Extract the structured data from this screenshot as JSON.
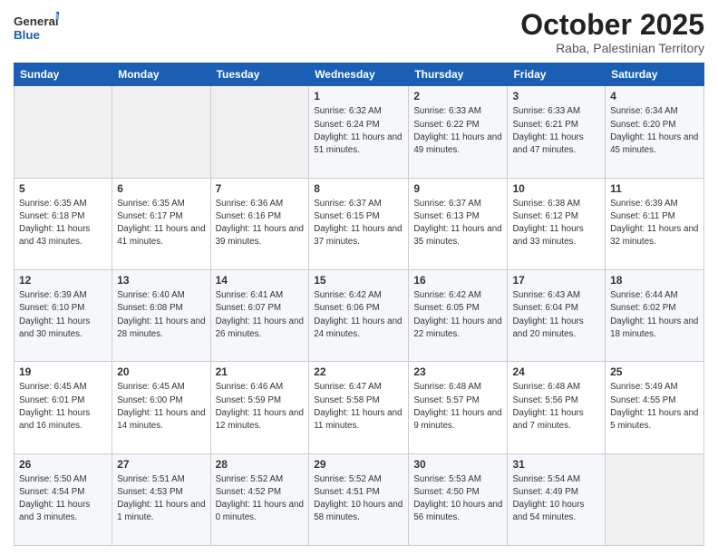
{
  "header": {
    "logo_general": "General",
    "logo_blue": "Blue",
    "main_title": "October 2025",
    "subtitle": "Raba, Palestinian Territory"
  },
  "days_of_week": [
    "Sunday",
    "Monday",
    "Tuesday",
    "Wednesday",
    "Thursday",
    "Friday",
    "Saturday"
  ],
  "weeks": [
    [
      {
        "day": "",
        "sunrise": "",
        "sunset": "",
        "daylight": "",
        "empty": true
      },
      {
        "day": "",
        "sunrise": "",
        "sunset": "",
        "daylight": "",
        "empty": true
      },
      {
        "day": "",
        "sunrise": "",
        "sunset": "",
        "daylight": "",
        "empty": true
      },
      {
        "day": "1",
        "sunrise": "Sunrise: 6:32 AM",
        "sunset": "Sunset: 6:24 PM",
        "daylight": "Daylight: 11 hours and 51 minutes."
      },
      {
        "day": "2",
        "sunrise": "Sunrise: 6:33 AM",
        "sunset": "Sunset: 6:22 PM",
        "daylight": "Daylight: 11 hours and 49 minutes."
      },
      {
        "day": "3",
        "sunrise": "Sunrise: 6:33 AM",
        "sunset": "Sunset: 6:21 PM",
        "daylight": "Daylight: 11 hours and 47 minutes."
      },
      {
        "day": "4",
        "sunrise": "Sunrise: 6:34 AM",
        "sunset": "Sunset: 6:20 PM",
        "daylight": "Daylight: 11 hours and 45 minutes."
      }
    ],
    [
      {
        "day": "5",
        "sunrise": "Sunrise: 6:35 AM",
        "sunset": "Sunset: 6:18 PM",
        "daylight": "Daylight: 11 hours and 43 minutes."
      },
      {
        "day": "6",
        "sunrise": "Sunrise: 6:35 AM",
        "sunset": "Sunset: 6:17 PM",
        "daylight": "Daylight: 11 hours and 41 minutes."
      },
      {
        "day": "7",
        "sunrise": "Sunrise: 6:36 AM",
        "sunset": "Sunset: 6:16 PM",
        "daylight": "Daylight: 11 hours and 39 minutes."
      },
      {
        "day": "8",
        "sunrise": "Sunrise: 6:37 AM",
        "sunset": "Sunset: 6:15 PM",
        "daylight": "Daylight: 11 hours and 37 minutes."
      },
      {
        "day": "9",
        "sunrise": "Sunrise: 6:37 AM",
        "sunset": "Sunset: 6:13 PM",
        "daylight": "Daylight: 11 hours and 35 minutes."
      },
      {
        "day": "10",
        "sunrise": "Sunrise: 6:38 AM",
        "sunset": "Sunset: 6:12 PM",
        "daylight": "Daylight: 11 hours and 33 minutes."
      },
      {
        "day": "11",
        "sunrise": "Sunrise: 6:39 AM",
        "sunset": "Sunset: 6:11 PM",
        "daylight": "Daylight: 11 hours and 32 minutes."
      }
    ],
    [
      {
        "day": "12",
        "sunrise": "Sunrise: 6:39 AM",
        "sunset": "Sunset: 6:10 PM",
        "daylight": "Daylight: 11 hours and 30 minutes."
      },
      {
        "day": "13",
        "sunrise": "Sunrise: 6:40 AM",
        "sunset": "Sunset: 6:08 PM",
        "daylight": "Daylight: 11 hours and 28 minutes."
      },
      {
        "day": "14",
        "sunrise": "Sunrise: 6:41 AM",
        "sunset": "Sunset: 6:07 PM",
        "daylight": "Daylight: 11 hours and 26 minutes."
      },
      {
        "day": "15",
        "sunrise": "Sunrise: 6:42 AM",
        "sunset": "Sunset: 6:06 PM",
        "daylight": "Daylight: 11 hours and 24 minutes."
      },
      {
        "day": "16",
        "sunrise": "Sunrise: 6:42 AM",
        "sunset": "Sunset: 6:05 PM",
        "daylight": "Daylight: 11 hours and 22 minutes."
      },
      {
        "day": "17",
        "sunrise": "Sunrise: 6:43 AM",
        "sunset": "Sunset: 6:04 PM",
        "daylight": "Daylight: 11 hours and 20 minutes."
      },
      {
        "day": "18",
        "sunrise": "Sunrise: 6:44 AM",
        "sunset": "Sunset: 6:02 PM",
        "daylight": "Daylight: 11 hours and 18 minutes."
      }
    ],
    [
      {
        "day": "19",
        "sunrise": "Sunrise: 6:45 AM",
        "sunset": "Sunset: 6:01 PM",
        "daylight": "Daylight: 11 hours and 16 minutes."
      },
      {
        "day": "20",
        "sunrise": "Sunrise: 6:45 AM",
        "sunset": "Sunset: 6:00 PM",
        "daylight": "Daylight: 11 hours and 14 minutes."
      },
      {
        "day": "21",
        "sunrise": "Sunrise: 6:46 AM",
        "sunset": "Sunset: 5:59 PM",
        "daylight": "Daylight: 11 hours and 12 minutes."
      },
      {
        "day": "22",
        "sunrise": "Sunrise: 6:47 AM",
        "sunset": "Sunset: 5:58 PM",
        "daylight": "Daylight: 11 hours and 11 minutes."
      },
      {
        "day": "23",
        "sunrise": "Sunrise: 6:48 AM",
        "sunset": "Sunset: 5:57 PM",
        "daylight": "Daylight: 11 hours and 9 minutes."
      },
      {
        "day": "24",
        "sunrise": "Sunrise: 6:48 AM",
        "sunset": "Sunset: 5:56 PM",
        "daylight": "Daylight: 11 hours and 7 minutes."
      },
      {
        "day": "25",
        "sunrise": "Sunrise: 5:49 AM",
        "sunset": "Sunset: 4:55 PM",
        "daylight": "Daylight: 11 hours and 5 minutes."
      }
    ],
    [
      {
        "day": "26",
        "sunrise": "Sunrise: 5:50 AM",
        "sunset": "Sunset: 4:54 PM",
        "daylight": "Daylight: 11 hours and 3 minutes."
      },
      {
        "day": "27",
        "sunrise": "Sunrise: 5:51 AM",
        "sunset": "Sunset: 4:53 PM",
        "daylight": "Daylight: 11 hours and 1 minute."
      },
      {
        "day": "28",
        "sunrise": "Sunrise: 5:52 AM",
        "sunset": "Sunset: 4:52 PM",
        "daylight": "Daylight: 11 hours and 0 minutes."
      },
      {
        "day": "29",
        "sunrise": "Sunrise: 5:52 AM",
        "sunset": "Sunset: 4:51 PM",
        "daylight": "Daylight: 10 hours and 58 minutes."
      },
      {
        "day": "30",
        "sunrise": "Sunrise: 5:53 AM",
        "sunset": "Sunset: 4:50 PM",
        "daylight": "Daylight: 10 hours and 56 minutes."
      },
      {
        "day": "31",
        "sunrise": "Sunrise: 5:54 AM",
        "sunset": "Sunset: 4:49 PM",
        "daylight": "Daylight: 10 hours and 54 minutes."
      },
      {
        "day": "",
        "sunrise": "",
        "sunset": "",
        "daylight": "",
        "empty": true
      }
    ]
  ]
}
